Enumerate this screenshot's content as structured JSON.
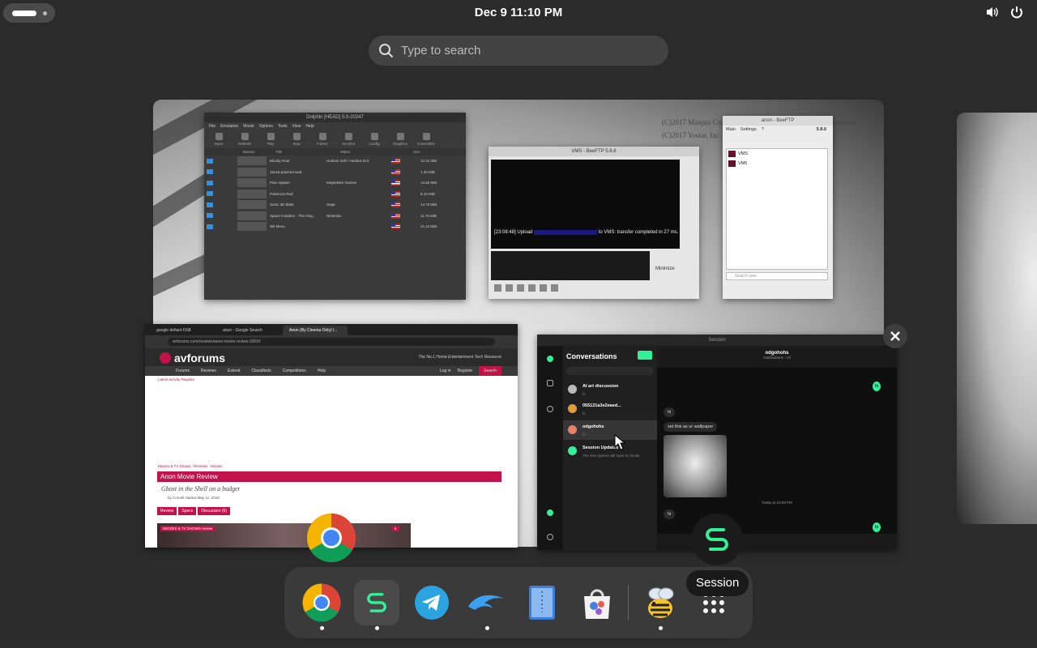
{
  "topbar": {
    "clock": "Dec 9  11:10 PM",
    "icons": [
      "volume-icon",
      "power-icon"
    ]
  },
  "search": {
    "placeholder": "Type to search"
  },
  "wallpaper": {
    "copyright_1": "(C)2017 Manjuu Co.,Ltd. & Yongshi Co.,Ltd. All Rights Reserved.",
    "copyright_2": "(C)2017 Yostar, Inc. All Rights Reserved."
  },
  "dolphin": {
    "title": "Dolphin [HEAD] 5.0-20247",
    "menu": [
      "File",
      "Emulation",
      "Movie",
      "Options",
      "Tools",
      "View",
      "Help"
    ],
    "tools": [
      "Open",
      "Refresh",
      "Play",
      "Stop",
      "FullScr",
      "ScrShot",
      "Config",
      "Graphics",
      "Controllers"
    ],
    "columns": [
      "Banner",
      "Title",
      "Maker",
      "Size"
    ],
    "games": [
      {
        "title": "Bloody Roar",
        "maker": "Hudson Soft / Hudson Ent.",
        "size": "12.22 MiB"
      },
      {
        "title": "16x16-patched.wad",
        "maker": "",
        "size": "1.33 MiB"
      },
      {
        "title": "Pixie Splash",
        "maker": "KleptoNick Games",
        "size": "14.55 MiB"
      },
      {
        "title": "Pokemon Red",
        "maker": "",
        "size": "6.10 MiB"
      },
      {
        "title": "Sonic 3D Blast",
        "maker": "Sega",
        "size": "14.75 MiB"
      },
      {
        "title": "Space Invaders · The Orig...",
        "maker": "Nintendo",
        "size": "11.76 MiB"
      },
      {
        "title": "Wii Menu",
        "maker": "",
        "size": "21.24 MiB"
      }
    ]
  },
  "vms": {
    "title": "VMS - BeeFTP 5.8.6",
    "log_time": "[23:08:48]",
    "log_upload": "Upload",
    "log_rest": "to VMS: transfer completed in 27 ms.",
    "minimize": "Minimize"
  },
  "beeftp": {
    "title": "anon - BeeFTP",
    "menus": [
      "Main",
      "Settings",
      "?"
    ],
    "version": "5.8.6",
    "vms": [
      "VMS",
      "VM6"
    ],
    "footer": "Search user"
  },
  "browser": {
    "tabs": [
      "google defiant f168",
      "anon - Google Search",
      "Anon (By Cinema Only) I..."
    ],
    "url": "avforums.com/reviews/anon-movie-review.18910",
    "logo": "avforums",
    "tagline": "The No.1 Home Entertainment Tech Resource",
    "nav": [
      "Forums",
      "Reviews",
      "Extend",
      "Classifieds",
      "Competitions",
      "Help"
    ],
    "login": "Log in",
    "register": "Register",
    "search": "Search",
    "latest": "Latest activity    Register",
    "breadcrumb": "Movies & TV Shows  ›  Reviews  ›  Movies",
    "article_title": "Anon Movie Review",
    "subtitle": "Ghost in the Shell on a budget",
    "byline": "by Cornell Hadow  May 11, 2018",
    "review_tabs": [
      "Review",
      "Specs",
      "Discussion (6)"
    ],
    "hero_tag": "MOVIES & TV SHOWS  review",
    "comments": "6"
  },
  "session": {
    "title": "Session",
    "conversations_label": "Conversations",
    "conversations": [
      {
        "name": "AI art discussion",
        "preview": "hi",
        "color": "#bbbbbb"
      },
      {
        "name": "055121a3e2eaed...",
        "preview": "hi",
        "color": "#e89a3a"
      },
      {
        "name": "odgohohs",
        "preview": "hi",
        "color": "#e8806a"
      },
      {
        "name": "Session Updates",
        "preview": "The new system will have to clouds",
        "color": "#31f196"
      }
    ],
    "chat_name": "odgohohs",
    "chat_sub": "Notifications - All",
    "msg_hi": "hi",
    "msg_wallpaper": "set this as ur wallpaper",
    "today": "Today at 10:58 PM"
  },
  "dock": {
    "apps": [
      "Google Chrome",
      "Session",
      "Telegram",
      "Dolphin",
      "Text Editor",
      "Software",
      "BeeFTP"
    ],
    "app_grid": "Show Apps",
    "tooltip": "Session"
  }
}
